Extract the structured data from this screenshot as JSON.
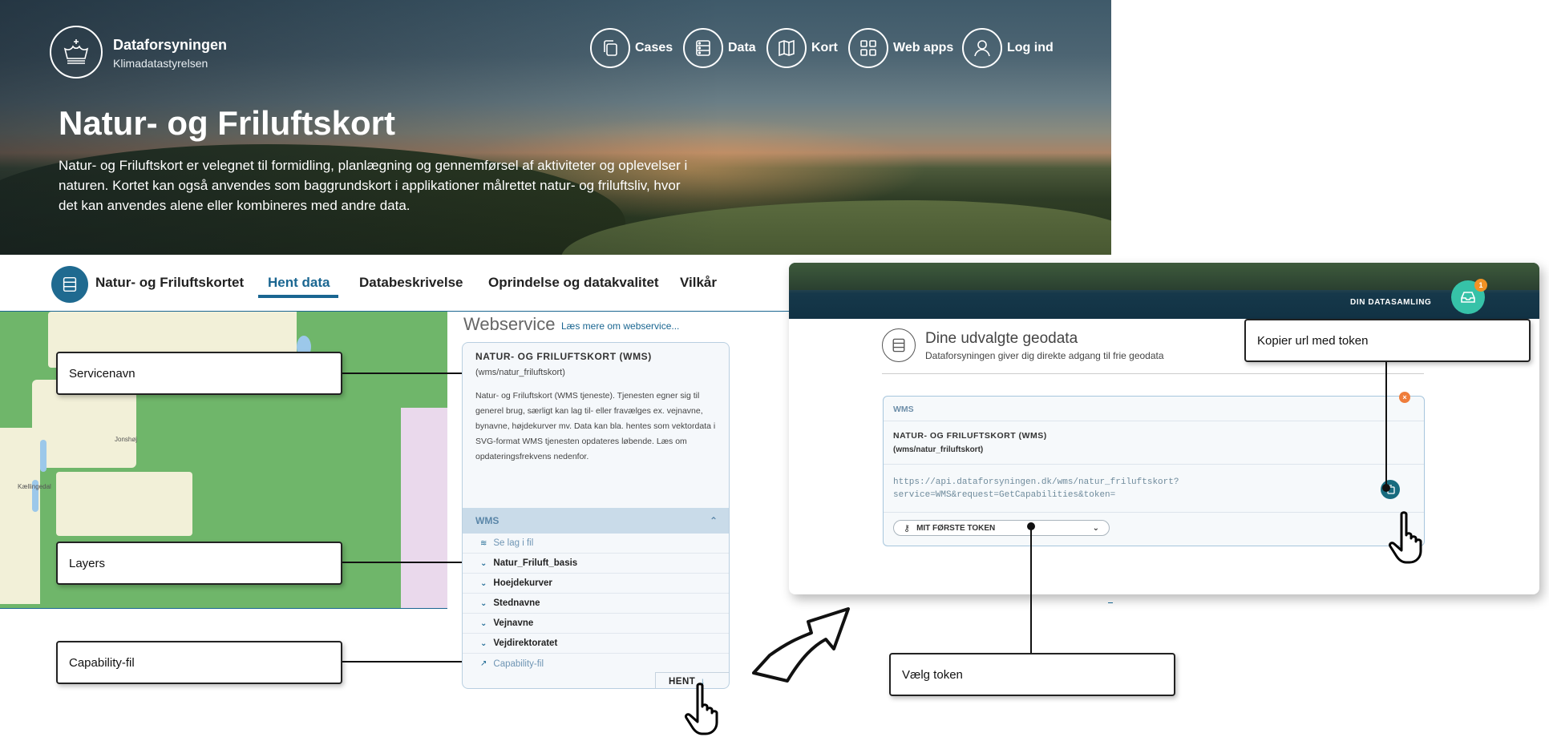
{
  "header": {
    "org_name": "Dataforsyningen",
    "org_sub": "Klimadatastyrelsen",
    "nav": [
      {
        "label": "Cases",
        "icon": "copy-icon"
      },
      {
        "label": "Data",
        "icon": "server-icon"
      },
      {
        "label": "Kort",
        "icon": "map-icon"
      },
      {
        "label": "Web apps",
        "icon": "grid-icon"
      },
      {
        "label": "Log ind",
        "icon": "user-icon"
      }
    ]
  },
  "hero": {
    "title": "Natur- og Friluftskort",
    "description": "Natur- og Friluftskort er velegnet til formidling, planlægning og gennemførsel af aktiviteter og oplevelser i naturen. Kortet kan også anvendes som baggrundskort i applikationer målrettet natur- og friluftsliv, hvor det kan anvendes alene eller kombineres med andre data."
  },
  "subnav": {
    "title": "Natur- og Friluftskortet",
    "tabs": [
      "Hent data",
      "Databeskrivelse",
      "Oprindelse og datakvalitet",
      "Vilkår"
    ],
    "active_tab": "Hent data"
  },
  "map": {
    "labels": [
      "Jonshøj",
      "Kællingedal"
    ]
  },
  "callouts": {
    "servicenavn": "Servicenavn",
    "layers": "Layers",
    "capability": "Capability-fil",
    "kopier": "Kopier url med token",
    "vaelg": "Vælg token"
  },
  "webservice": {
    "heading": "Webservice",
    "link": "Læs mere om webservice...",
    "card_title": "NATUR- OG FRILUFTSKORT (WMS)",
    "path": "(wms/natur_friluftskort)",
    "description": "Natur- og Friluftskort (WMS tjeneste). Tjenesten egner sig til generel brug, særligt kan lag til- eller fravælges ex. vejnavne, bynavne, højdekurver mv. Data kan bla. hentes som vektordata i SVG-format WMS tjenesten opdateres løbende. Læs om opdateringsfrekvens nedenfor.",
    "section": "WMS",
    "see_layers": "Se lag i fil",
    "layers": [
      "Natur_Friluft_basis",
      "Hoejdekurver",
      "Stednavne",
      "Vejnavne",
      "Vejdirektoratet"
    ],
    "capability": "Capability-fil",
    "hent": "HENT"
  },
  "datasamling": {
    "label": "DIN DATASAMLING",
    "badge": "1",
    "title": "Dine udvalgte geodata",
    "subtitle": "Dataforsyningen giver dig direkte adgang til frie geodata",
    "wms": "WMS",
    "card_title": "NATUR- OG FRILUFTSKORT (WMS)",
    "card_path": "(wms/natur_friluftskort)",
    "url_line1": "https://api.dataforsyningen.dk/wms/natur_friluftskort?",
    "url_line2": "service=WMS&request=GetCapabilities&token=",
    "token": "MIT FØRSTE TOKEN"
  },
  "colors": {
    "accent": "#1a6691",
    "teal": "#36c2a8",
    "close": "#ef7d3c"
  }
}
